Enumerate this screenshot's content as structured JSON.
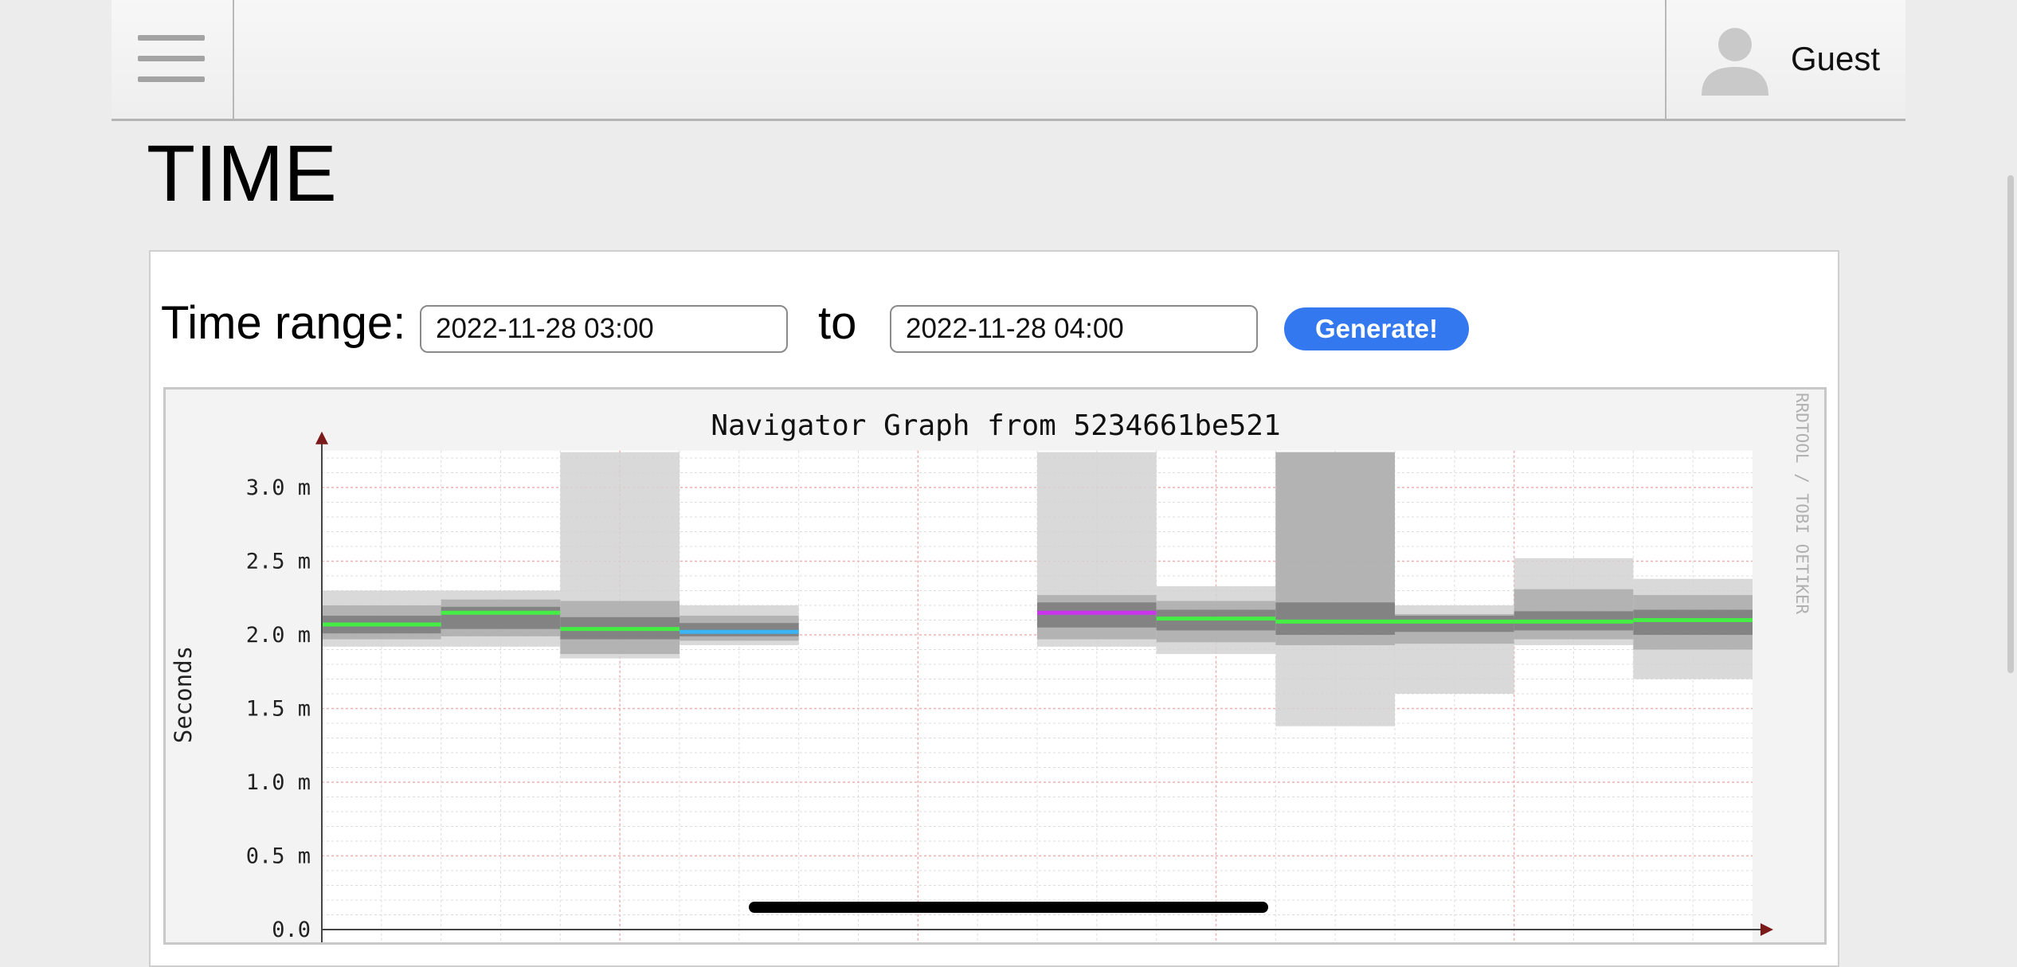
{
  "header": {
    "menu_icon": "hamburger-menu-icon",
    "user_icon": "person-avatar-icon",
    "user_name": "Guest"
  },
  "page": {
    "title": "TIME"
  },
  "time_range": {
    "label": "Time range:",
    "from_value": "2022-11-28 03:00",
    "to_label": "to",
    "to_value": "2022-11-28 04:00",
    "generate_label": "Generate!"
  },
  "chart_data": {
    "type": "line",
    "title": "Navigator Graph from 5234661be521",
    "ylabel": "Seconds",
    "watermark": "RRDTOOL / TOBI OETIKER",
    "y_ticks": [
      "0.0",
      "0.5 m",
      "1.0 m",
      "1.5 m",
      "2.0 m",
      "2.5 m",
      "3.0 m"
    ],
    "ylim": [
      0,
      3.25
    ],
    "grid": true,
    "n_slots": 12,
    "segments": [
      {
        "slot": 0,
        "median": 2.07,
        "color": "#44ee44",
        "bands": [
          [
            1.92,
            2.3
          ],
          [
            1.97,
            2.2
          ],
          [
            2.01,
            2.13
          ]
        ]
      },
      {
        "slot": 1,
        "median": 2.15,
        "color": "#44ee44",
        "bands": [
          [
            1.92,
            2.3
          ],
          [
            1.99,
            2.24
          ],
          [
            2.04,
            2.19
          ]
        ]
      },
      {
        "slot": 2,
        "median": 2.04,
        "color": "#44ee44",
        "bands": [
          [
            1.84,
            3.24
          ],
          [
            1.87,
            2.23
          ],
          [
            1.97,
            2.12
          ]
        ]
      },
      {
        "slot": 3,
        "median": 2.02,
        "color": "#3ab4f2",
        "bands": [
          [
            1.93,
            2.2
          ],
          [
            1.96,
            2.13
          ],
          [
            1.99,
            2.08
          ]
        ]
      },
      {
        "slot": 6,
        "median": 2.15,
        "color": "#cc33ee",
        "bands": [
          [
            1.92,
            3.24
          ],
          [
            1.97,
            2.27
          ],
          [
            2.05,
            2.22
          ]
        ]
      },
      {
        "slot": 7,
        "median": 2.11,
        "color": "#44ee44",
        "bands": [
          [
            1.87,
            2.33
          ],
          [
            1.95,
            2.23
          ],
          [
            2.03,
            2.17
          ]
        ]
      },
      {
        "slot": 8,
        "median": 2.09,
        "color": "#44ee44",
        "bands": [
          [
            1.38,
            3.24
          ],
          [
            1.93,
            3.24
          ],
          [
            2.0,
            2.22
          ]
        ]
      },
      {
        "slot": 9,
        "median": 2.09,
        "color": "#44ee44",
        "bands": [
          [
            1.6,
            2.2
          ],
          [
            1.94,
            2.14
          ],
          [
            2.02,
            2.13
          ]
        ]
      },
      {
        "slot": 10,
        "median": 2.09,
        "color": "#44ee44",
        "bands": [
          [
            1.93,
            2.52
          ],
          [
            1.97,
            2.31
          ],
          [
            2.03,
            2.16
          ]
        ]
      },
      {
        "slot": 11,
        "median": 2.1,
        "color": "#44ee44",
        "bands": [
          [
            1.7,
            2.38
          ],
          [
            1.9,
            2.27
          ],
          [
            2.0,
            2.17
          ]
        ]
      }
    ]
  }
}
